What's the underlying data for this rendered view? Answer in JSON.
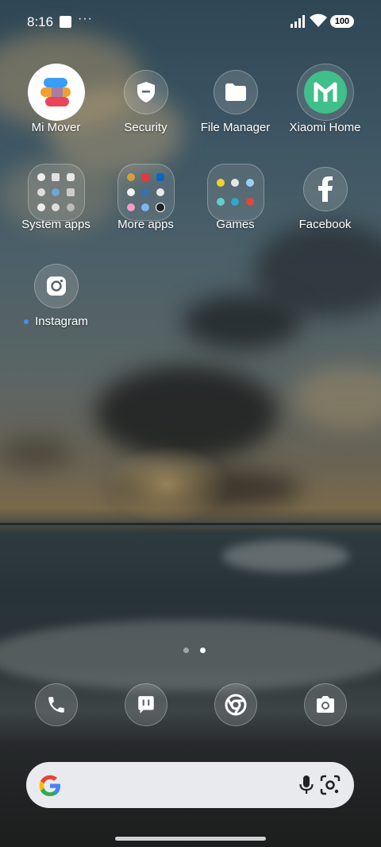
{
  "status_bar": {
    "time": "8:16",
    "more": "···",
    "battery": "100"
  },
  "apps_row1": [
    {
      "name": "Mi Mover"
    },
    {
      "name": "Security"
    },
    {
      "name": "File Manager"
    },
    {
      "name": "Xiaomi Home"
    }
  ],
  "apps_row2": [
    {
      "name": "System apps"
    },
    {
      "name": "More apps"
    },
    {
      "name": "Games"
    },
    {
      "name": "Facebook"
    }
  ],
  "apps_row3": [
    {
      "name": "Instagram"
    }
  ],
  "page_indicator": {
    "count": 2,
    "active": 1
  },
  "dock": [
    {
      "name": "Phone"
    },
    {
      "name": "Messages"
    },
    {
      "name": "Chrome"
    },
    {
      "name": "Camera"
    }
  ],
  "colors": {
    "search_bg": "#e8eaed",
    "new_dot": "#4a8cff",
    "xiaomi_home_green": "#3fbf8a"
  }
}
